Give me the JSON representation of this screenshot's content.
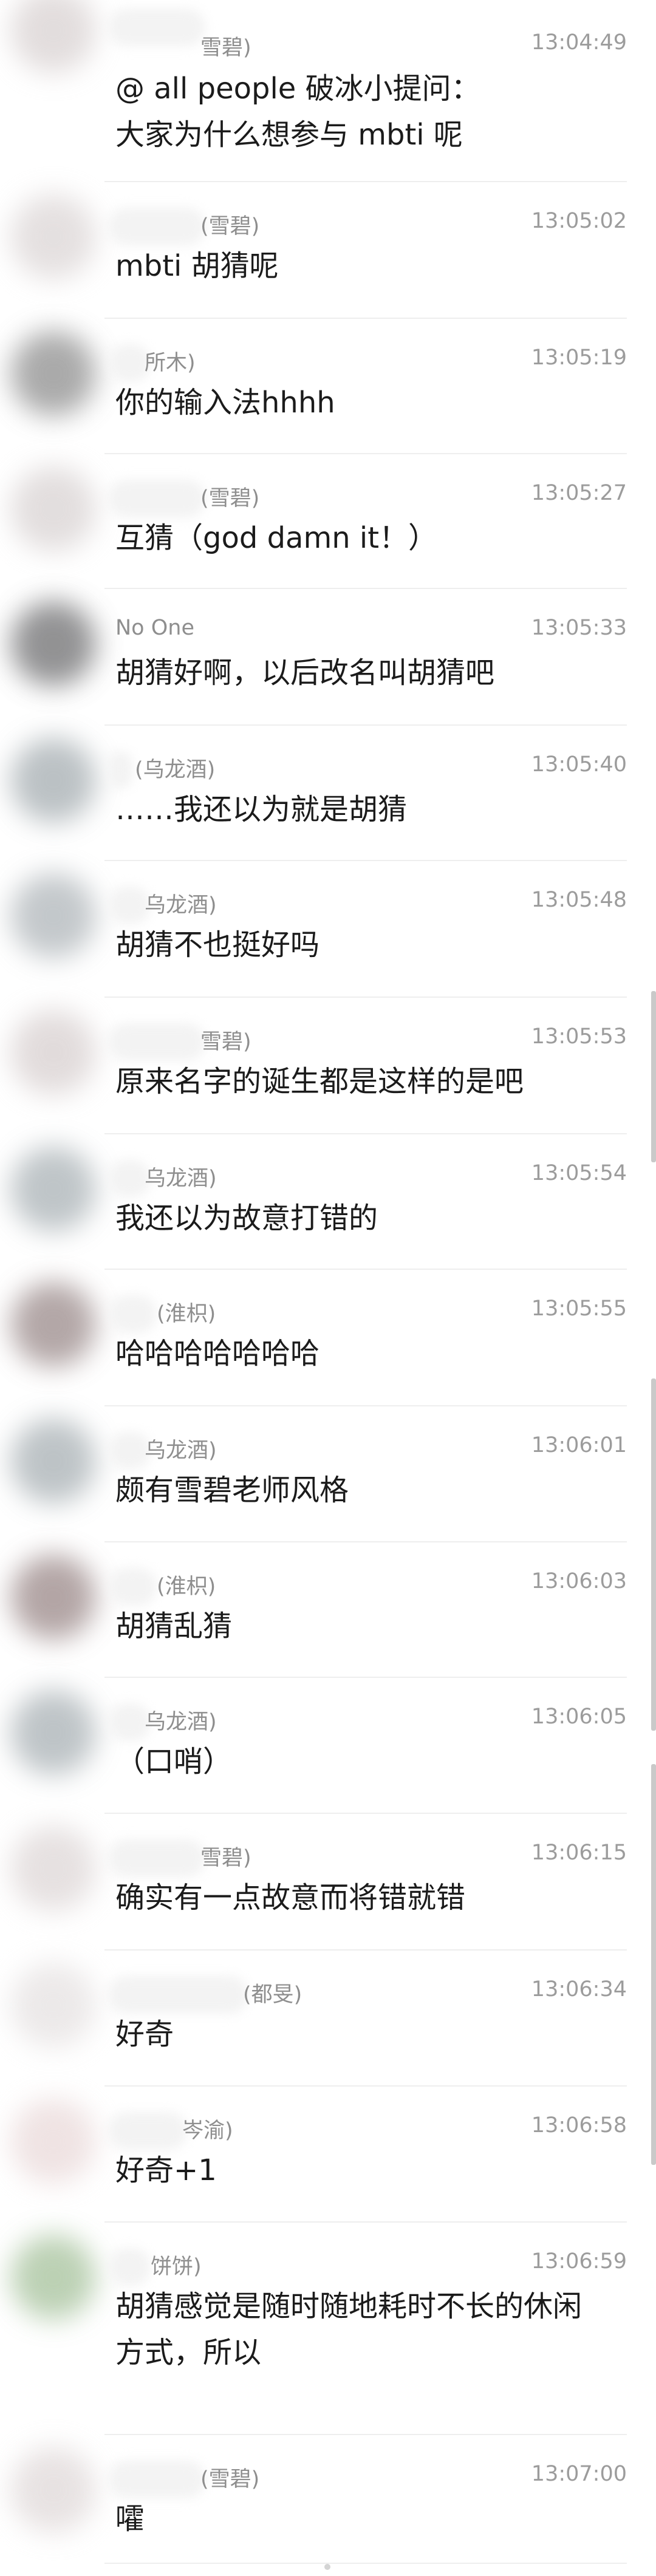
{
  "messages": [
    {
      "sender": "雪碧)",
      "time": "13:04:49",
      "text": "@ all people 破冰小提问：\n大家为什么想参与 mbti 呢",
      "avatar_color": "#d9d2d2"
    },
    {
      "sender": "(雪碧)",
      "time": "13:05:02",
      "text": "mbti 胡猜呢",
      "avatar_color": "#dcd6d6"
    },
    {
      "sender": "所木)",
      "time": "13:05:19",
      "text": "你的输入法hhhh",
      "avatar_color": "#8e8e8e"
    },
    {
      "sender": "(雪碧)",
      "time": "13:05:27",
      "text": "互猜（god damn it！）",
      "avatar_color": "#d9d3d3"
    },
    {
      "sender": "No One",
      "time": "13:05:33",
      "text": "胡猜好啊，以后改名叫胡猜吧",
      "avatar_color": "#6e6e70"
    },
    {
      "sender": "(乌龙酒)",
      "time": "13:05:40",
      "text": "……我还以为就是胡猜",
      "avatar_color": "#a5adb1"
    },
    {
      "sender": "乌龙酒)",
      "time": "13:05:48",
      "text": "胡猜不也挺好吗",
      "avatar_color": "#b0b6ba"
    },
    {
      "sender": "雪碧)",
      "time": "13:05:53",
      "text": "原来名字的诞生都是这样的是吧",
      "avatar_color": "#d8d0d0"
    },
    {
      "sender": "乌龙酒)",
      "time": "13:05:54",
      "text": "我还以为故意打错的",
      "avatar_color": "#aab2b6"
    },
    {
      "sender": "(淮枳)",
      "time": "13:05:55",
      "text": "哈哈哈哈哈哈哈",
      "avatar_color": "#9a8a8a"
    },
    {
      "sender": "乌龙酒)",
      "time": "13:06:01",
      "text": "颇有雪碧老师风格",
      "avatar_color": "#a8b0b4"
    },
    {
      "sender": "(淮枳)",
      "time": "13:06:03",
      "text": "胡猜乱猜",
      "avatar_color": "#9a8888"
    },
    {
      "sender": "乌龙酒)",
      "time": "13:06:05",
      "text": "（口哨）",
      "avatar_color": "#a9b1b5"
    },
    {
      "sender": "雪碧)",
      "time": "13:06:15",
      "text": "确实有一点故意而将错就错",
      "avatar_color": "#ded7d7"
    },
    {
      "sender": "(都旻)",
      "time": "13:06:34",
      "text": "好奇",
      "avatar_color": "#e6e2e2"
    },
    {
      "sender": "岑渝)",
      "time": "13:06:58",
      "text": "好奇+1",
      "avatar_color": "#eadada"
    },
    {
      "sender": "饼饼)",
      "time": "13:06:59",
      "text": "胡猜感觉是随时随地耗时不长的休闲\n方式，所以",
      "avatar_color": "#a6c29c"
    },
    {
      "sender": "(雪碧)",
      "time": "13:07:00",
      "text": "嚯",
      "avatar_color": "#e0d9d9"
    }
  ]
}
